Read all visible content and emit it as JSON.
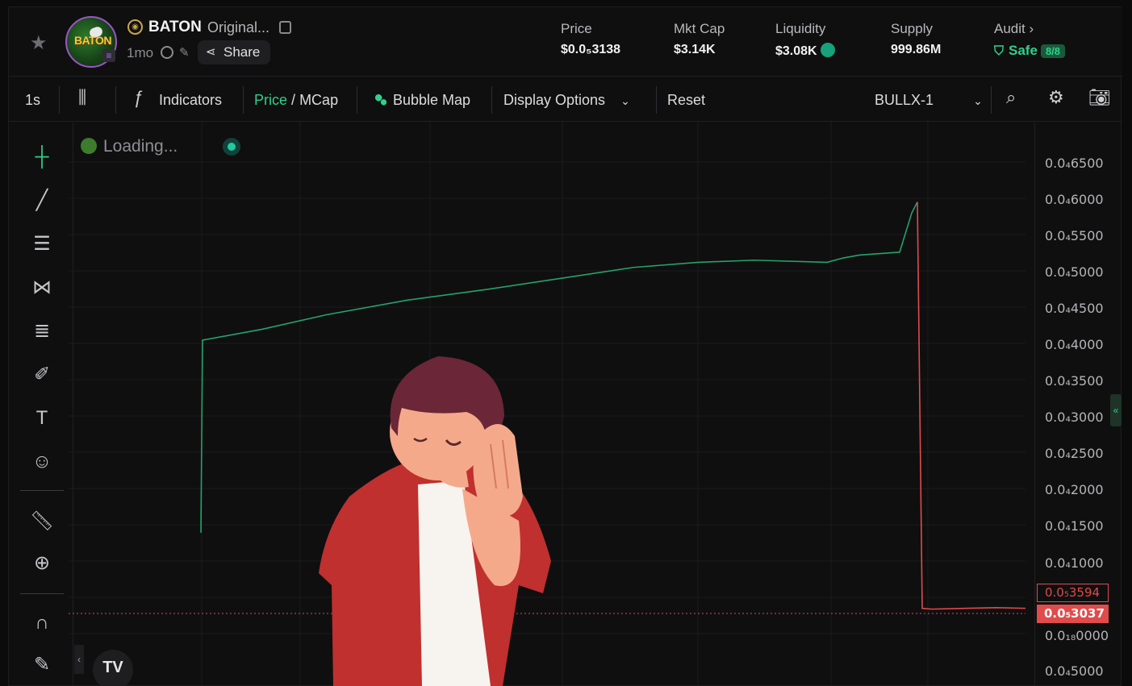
{
  "header": {
    "token_name": "BATON",
    "token_desc": "Original...",
    "age": "1mo",
    "share_label": "Share",
    "logo_text": "BATON",
    "stats": [
      {
        "label": "Price",
        "value": "$0.0₅3138"
      },
      {
        "label": "Mkt Cap",
        "value": "$3.14K"
      },
      {
        "label": "Liquidity",
        "value": "$3.08K"
      },
      {
        "label": "Supply",
        "value": "999.86M"
      }
    ],
    "audit": {
      "label": "Audit",
      "status": "Safe",
      "score": "8/8"
    }
  },
  "toolbar": {
    "interval": "1s",
    "indicators": "Indicators",
    "price": "Price",
    "slash": "/",
    "mcap": "MCap",
    "bubble_map": "Bubble Map",
    "display_options": "Display Options",
    "reset": "Reset",
    "source": "BULLX-1"
  },
  "chart": {
    "loading_text": "Loading...",
    "price_ticks": [
      "0.0₄6500",
      "0.0₄6000",
      "0.0₄5500",
      "0.0₄5000",
      "0.0₄4500",
      "0.0₄4000",
      "0.0₄3500",
      "0.0₄3000",
      "0.0₄2500",
      "0.0₄2000",
      "0.0₄1500",
      "0.0₄1000",
      "0.0₁₈0000",
      "0.0₄5000"
    ],
    "tag_high": "0.0₅3594",
    "tag_current": "0.0₅3037",
    "tv_logo": "TV"
  },
  "chart_data": {
    "type": "line",
    "series": [
      {
        "values": [
          1.4e-05,
          4.05e-05,
          4.2e-05,
          4.4e-05,
          4.6e-05,
          4.75e-05,
          4.9e-05,
          5.05e-05,
          5.12e-05,
          5.15e-05,
          5.12e-05,
          5.18e-05,
          5.22e-05,
          5.26e-05,
          5.8e-05,
          5.95e-05,
          3.6e-06,
          3.5e-06,
          3.6e-06,
          3.7e-06,
          3.6e-06
        ]
      }
    ],
    "ylim": [
      -5e-06,
      6.8e-05
    ],
    "colors": {
      "up": "#26a269",
      "down": "#e04b4b"
    }
  }
}
